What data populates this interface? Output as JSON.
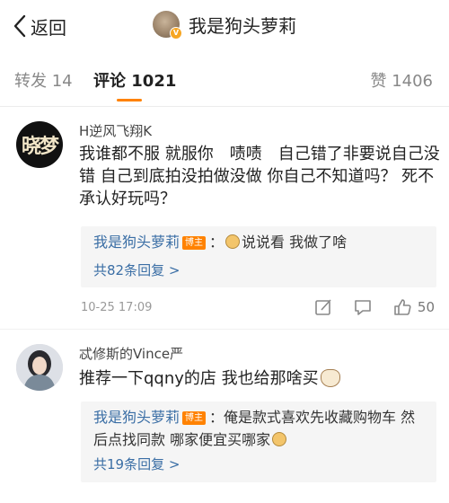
{
  "header": {
    "back_label": "返回",
    "title": "我是狗头萝莉",
    "verify_badge": "V"
  },
  "tabs": {
    "repost": "转发 14",
    "comment": "评论 1021",
    "like": "赞 1406"
  },
  "comments": [
    {
      "avatar_text": "晓梦",
      "username": "H逆风飞翔K",
      "text": "我谁都不服 就服你　啧啧　自己错了非要说自己没错 自己到底拍没拍做没做 你自己不知道吗？ 死不承认好玩吗？",
      "reply": {
        "name": "我是狗头萝莉",
        "badge": "博主",
        "sep": "：",
        "text": "说说看 我做了啥"
      },
      "more_replies": "共82条回复 >",
      "time": "10-25 17:09",
      "like_count": "50"
    },
    {
      "username": "忒修斯的Vince严",
      "text": "推荐一下qqny的店 我也给那啥买",
      "reply": {
        "name": "我是狗头萝莉",
        "badge": "博主",
        "sep": "：",
        "text": "俺是款式喜欢先收藏购物车 然后点找同款 哪家便宜买哪家"
      },
      "more_replies": "共19条回复 >"
    }
  ],
  "colors": {
    "accent": "#ff8200",
    "link": "#3a6ea5",
    "muted": "#999999"
  }
}
